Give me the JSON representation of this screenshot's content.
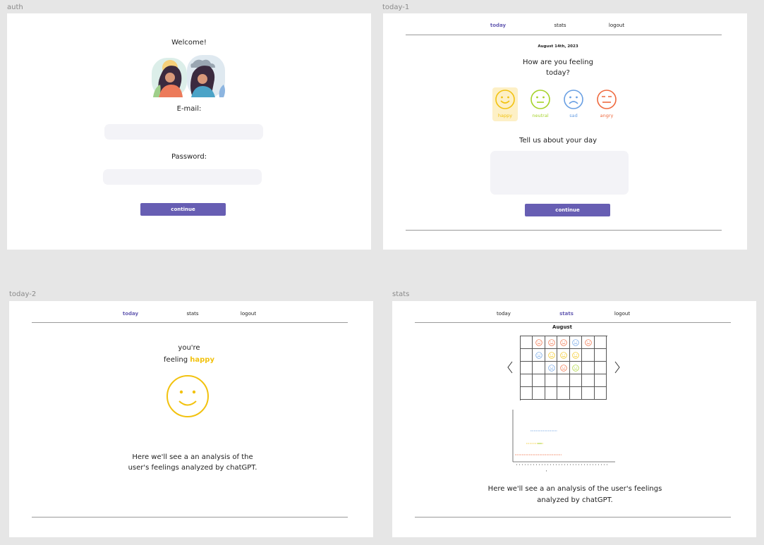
{
  "frames": {
    "auth": "auth",
    "today1": "today-1",
    "today2": "today-2",
    "stats": "stats"
  },
  "auth": {
    "welcome": "Welcome!",
    "email_label": "E-mail:",
    "password_label": "Password:",
    "continue": "continue"
  },
  "nav": {
    "today": "today",
    "stats": "stats",
    "logout": "logout"
  },
  "today1": {
    "date": "August 14th, 2023",
    "question_line1": "How are you feeling",
    "question_line2": "today?",
    "moods": [
      {
        "label": "happy",
        "color": "#f2c20f",
        "selected": true
      },
      {
        "label": "neutral",
        "color": "#a6d22b"
      },
      {
        "label": "sad",
        "color": "#6aa0e3"
      },
      {
        "label": "angry",
        "color": "#ef6a3f"
      }
    ],
    "tell_us": "Tell us about your day",
    "continue": "continue"
  },
  "today2": {
    "youre": "you're",
    "feeling": "feeling",
    "mood": "happy",
    "analysis_line1": "Here we'll see a an analysis of the",
    "analysis_line2": "user's feelings analyzed by chatGPT."
  },
  "stats": {
    "month": "August",
    "analysis_line1": "Here we'll see a an analysis of the user's feelings",
    "analysis_line2": "analyzed by chatGPT.",
    "calendar_icons": [
      {
        "row": 0,
        "col": 1,
        "mood": "angry"
      },
      {
        "row": 0,
        "col": 2,
        "mood": "angry"
      },
      {
        "row": 0,
        "col": 3,
        "mood": "angry"
      },
      {
        "row": 0,
        "col": 4,
        "mood": "sad"
      },
      {
        "row": 0,
        "col": 5,
        "mood": "angry"
      },
      {
        "row": 1,
        "col": 1,
        "mood": "sad"
      },
      {
        "row": 1,
        "col": 2,
        "mood": "happy"
      },
      {
        "row": 1,
        "col": 3,
        "mood": "happy"
      },
      {
        "row": 1,
        "col": 4,
        "mood": "happy"
      },
      {
        "row": 2,
        "col": 2,
        "mood": "sad"
      },
      {
        "row": 2,
        "col": 3,
        "mood": "angry"
      },
      {
        "row": 2,
        "col": 4,
        "mood": "neutral"
      }
    ]
  },
  "colors": {
    "accent": "#675eb3",
    "happy": "#f2c20f",
    "neutral": "#a6d22b",
    "sad": "#6aa0e3",
    "angry": "#ef6a3f"
  }
}
